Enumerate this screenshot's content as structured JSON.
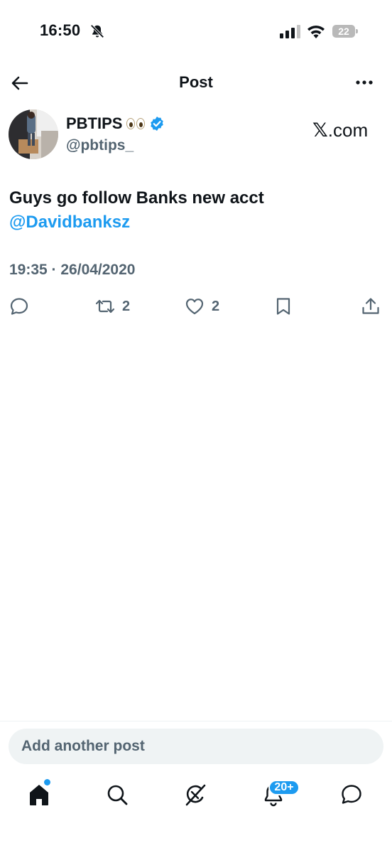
{
  "status_bar": {
    "time": "16:50",
    "battery": "22"
  },
  "header": {
    "title": "Post"
  },
  "post": {
    "author_name": "PBTIPS",
    "author_handle": "@pbtips_",
    "source": ".com",
    "text": "Guys go follow Banks new acct",
    "mention": "@Davidbanksz",
    "timestamp": "19:35 · 26/04/2020",
    "actions": {
      "reposts": "2",
      "likes": "2"
    }
  },
  "compose": {
    "placeholder": "Add another post"
  },
  "tab_bar": {
    "notifications_badge": "20+"
  },
  "colors": {
    "accent": "#1d9bf0",
    "secondary_text": "#536471",
    "primary_text": "#0f1419"
  },
  "icons": [
    "bell-off-icon",
    "signal-icon",
    "wifi-icon",
    "battery-icon",
    "back-arrow-icon",
    "more-icon",
    "verified-badge-icon",
    "eyes-emoji-icon",
    "x-logo-icon",
    "reply-icon",
    "repost-icon",
    "like-icon",
    "bookmark-icon",
    "share-icon",
    "home-icon",
    "search-icon",
    "grok-icon",
    "notifications-icon",
    "messages-icon"
  ]
}
